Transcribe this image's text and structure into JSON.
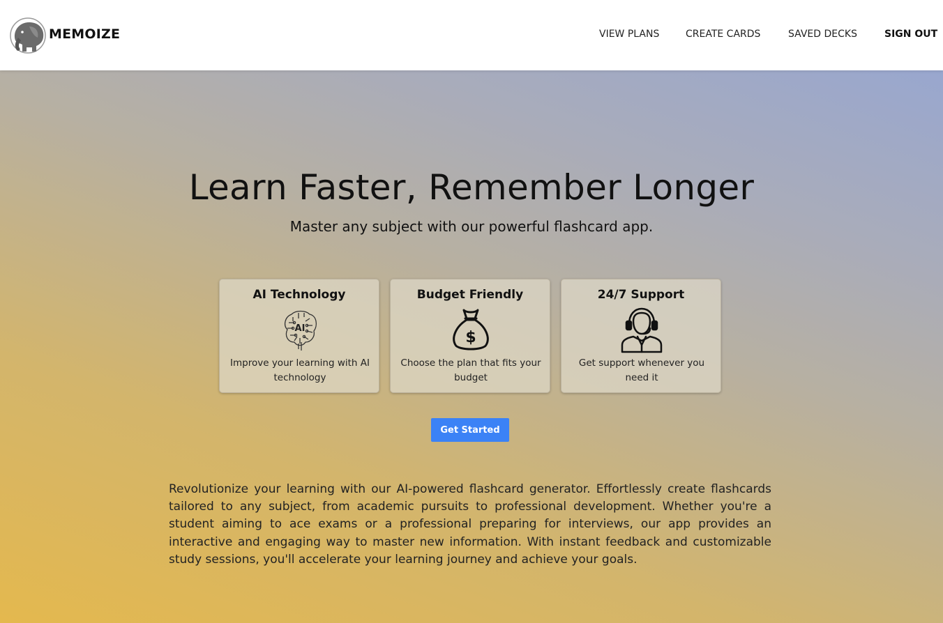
{
  "header": {
    "brand": "MEMOIZE",
    "logo_icon": "elephant-logo-icon",
    "nav": {
      "view_plans": "VIEW PLANS",
      "create_cards": "CREATE CARDS",
      "saved_decks": "SAVED DECKS",
      "sign_out": "SIGN OUT"
    }
  },
  "hero": {
    "title": "Learn Faster, Remember Longer",
    "subtitle": "Master any subject with our powerful flashcard app."
  },
  "features": [
    {
      "title": "AI Technology",
      "icon": "ai-brain-icon",
      "description": "Improve your learning with AI technology",
      "icon_text": "AI"
    },
    {
      "title": "Budget Friendly",
      "icon": "money-bag-icon",
      "description": "Choose the plan that fits your budget",
      "icon_text": "$"
    },
    {
      "title": "24/7 Support",
      "icon": "support-agent-icon",
      "description": "Get support whenever you need it"
    }
  ],
  "cta": {
    "label": "Get Started",
    "color": "#3b82f6"
  },
  "about": {
    "text": "Revolutionize your learning with our AI-powered flashcard generator. Effortlessly create flashcards tailored to any subject, from academic pursuits to professional development. Whether you're a student aiming to ace exams or a professional preparing for interviews, our app provides an interactive and engaging way to master new information. With instant feedback and customizable study sessions, you'll accelerate your learning journey and achieve your goals."
  }
}
